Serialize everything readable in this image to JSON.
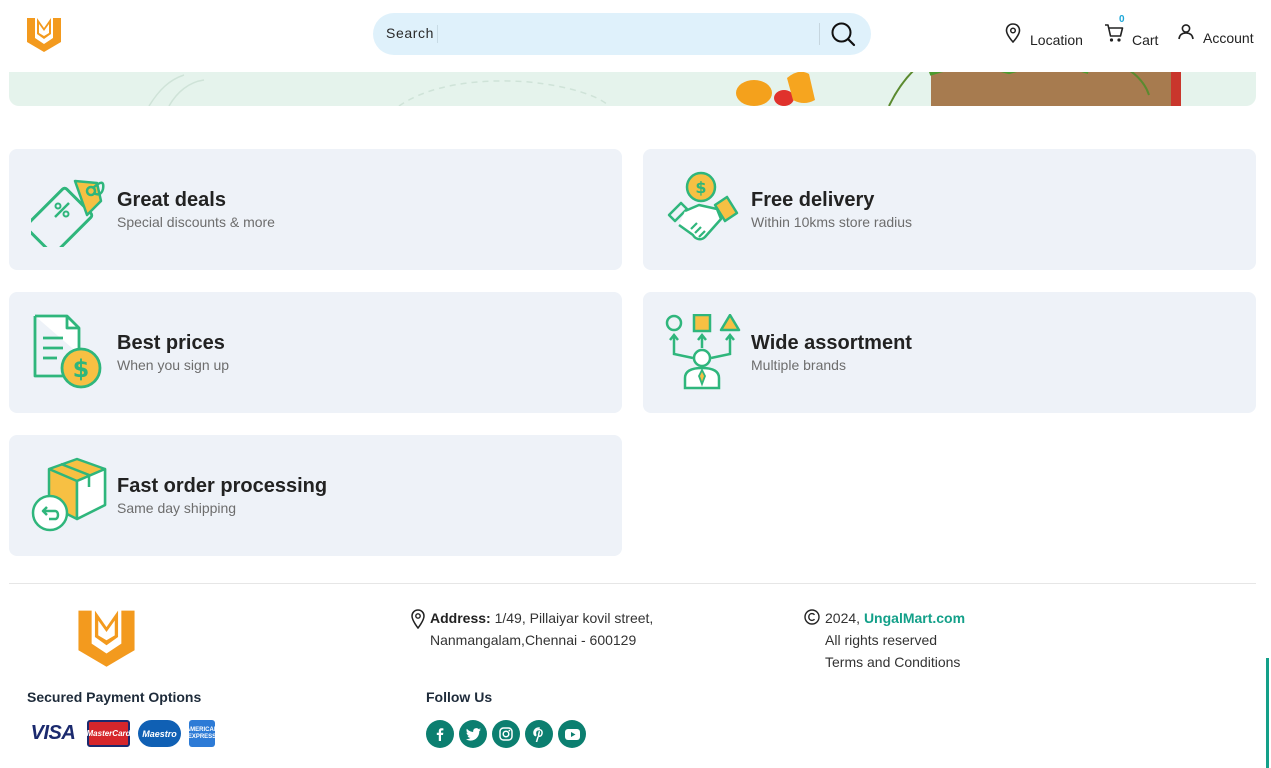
{
  "header": {
    "search_placeholder": "Search",
    "location_label": "Location",
    "cart_label": "Cart",
    "cart_count": "0",
    "account_label": "Account"
  },
  "features": [
    {
      "title": "Great deals",
      "subtitle": "Special discounts & more",
      "icon": "discount-tag-icon"
    },
    {
      "title": "Free delivery",
      "subtitle": "Within 10kms store radius",
      "icon": "handshake-money-icon"
    },
    {
      "title": "Best prices",
      "subtitle": "When you sign up",
      "icon": "price-document-icon"
    },
    {
      "title": "Wide assortment",
      "subtitle": "Multiple brands",
      "icon": "shapes-assortment-icon"
    },
    {
      "title": "Fast order processing",
      "subtitle": "Same day shipping",
      "icon": "box-return-icon"
    }
  ],
  "footer": {
    "address_label": "Address:",
    "address_line1": " 1/49, Pillaiyar kovil street,",
    "address_line2": "Nanmangalam,Chennai - 600129",
    "copyright_year": "2024,",
    "brand_name": "UngalMart.com",
    "rights": "All rights reserved",
    "terms": "Terms and Conditions",
    "payment_heading": "Secured Payment Options",
    "follow_heading": "Follow Us",
    "payment_methods": {
      "visa": "VISA",
      "mastercard": "MasterCard",
      "maestro": "Maestro",
      "amex": "AMERICAN EXPRESS"
    },
    "social": [
      "facebook-icon",
      "twitter-icon",
      "instagram-icon",
      "pinterest-icon",
      "youtube-icon"
    ]
  },
  "colors": {
    "accent_green": "#13a089",
    "icon_green": "#2fb67c",
    "icon_yellow": "#f7c043",
    "logo_orange": "#f39a1e",
    "card_bg": "#eef2f8",
    "search_bg": "#dff1fb",
    "social_bg": "#0c7f70"
  }
}
